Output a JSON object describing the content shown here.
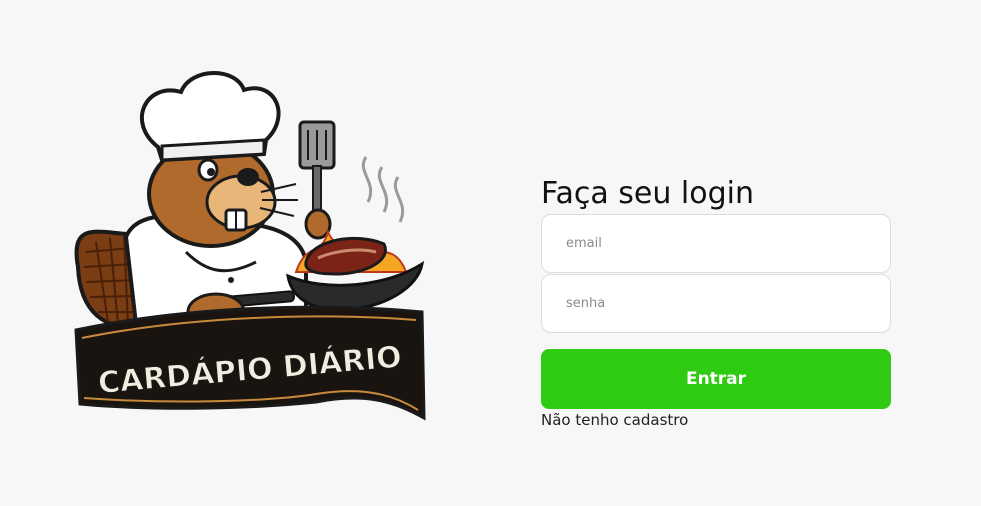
{
  "logo": {
    "banner_text": "CARDÁPIO DIÁRIO",
    "icon": "beaver-chef-logo"
  },
  "login": {
    "title": "Faça seu login",
    "email_placeholder": "email",
    "password_placeholder": "senha",
    "submit_label": "Entrar",
    "register_link": "Não tenho cadastro"
  },
  "colors": {
    "background": "#f7f7f7",
    "button": "#2ecb12",
    "button_text": "#ffffff"
  }
}
